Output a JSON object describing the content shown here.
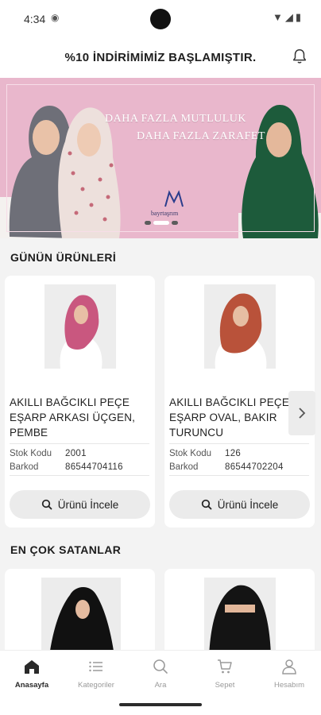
{
  "status_bar": {
    "time": "4:34"
  },
  "header": {
    "announcement": "%10  İNDİRİMİMİZ BAŞLAMIŞTIR."
  },
  "banner": {
    "line1": "DAHA FAZLA MUTLULUK",
    "line2": "DAHA FAZLA ZARAFET",
    "logo_text": "bayrtaşrım",
    "colors": {
      "background": "#e9b7cc"
    }
  },
  "daily": {
    "title": "GÜNÜN ÜRÜNLERİ",
    "products": [
      {
        "name": "AKILLI BAĞCIKLI PEÇE EŞARP ARKASI ÜÇGEN, PEMBE",
        "stock_label": "Stok Kodu",
        "stock_value": "2001",
        "barcode_label": "Barkod",
        "barcode_value": "86544704116",
        "button_label": "Ürünü İncele",
        "scarf_color": "#c9577f"
      },
      {
        "name": "AKILLI BAĞCIKLI PEÇE EŞARP OVAL, BAKIR TURUNCU",
        "stock_label": "Stok Kodu",
        "stock_value": "126",
        "barcode_label": "Barkod",
        "barcode_value": "86544702204",
        "button_label": "Ürünü İncele",
        "scarf_color": "#b9523a"
      }
    ]
  },
  "bestsellers": {
    "title": "EN ÇOK SATANLAR"
  },
  "nav": {
    "items": [
      {
        "label": "Anasayfa",
        "icon": "home-icon"
      },
      {
        "label": "Kategoriler",
        "icon": "list-icon"
      },
      {
        "label": "Ara",
        "icon": "search-icon"
      },
      {
        "label": "Sepet",
        "icon": "cart-icon"
      },
      {
        "label": "Hesabım",
        "icon": "user-icon"
      }
    ]
  }
}
